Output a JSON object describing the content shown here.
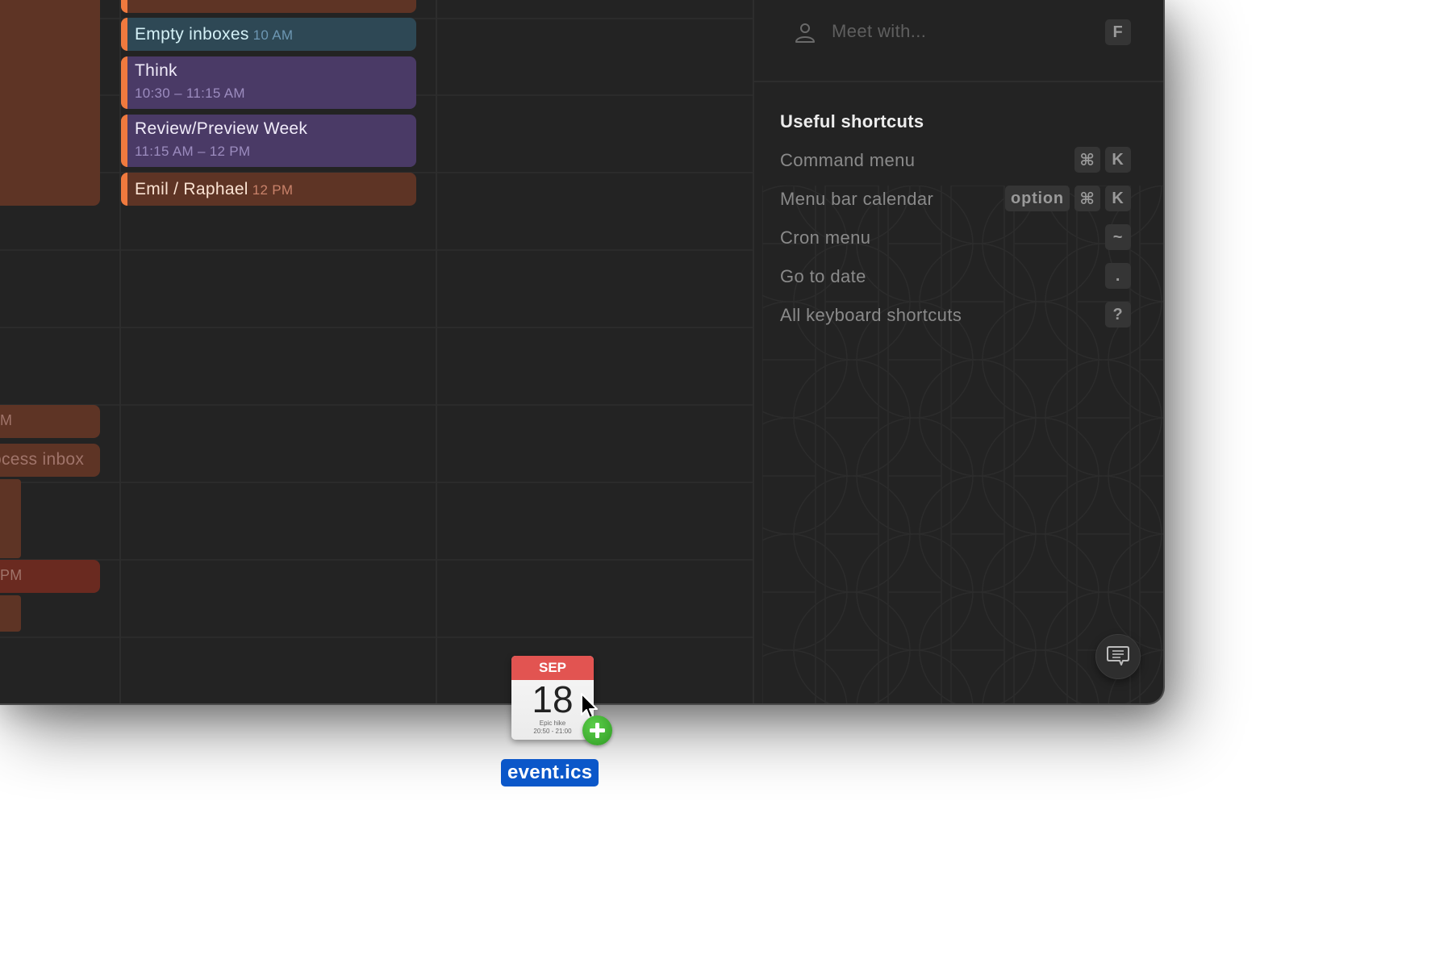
{
  "calendar": {
    "column_left": {
      "events": [
        {
          "label": "",
          "color": "#5e3425"
        },
        {
          "label": "M",
          "color": "#5e3425"
        },
        {
          "label": "ocess inbox",
          "color": "#5e3425"
        },
        {
          "label": "",
          "color": "#5e3425"
        },
        {
          "label": "PM",
          "color": "#6a2a20"
        },
        {
          "label": "",
          "color": "#5e3425"
        }
      ]
    },
    "column_main": {
      "events": [
        {
          "title": "",
          "time": "",
          "color": "#5e3425"
        },
        {
          "title": "Empty inboxes",
          "time": "10 AM",
          "color": "#2e4855"
        },
        {
          "title": "Think",
          "time": "10:30 – 11:15 AM",
          "color": "#4a3a66"
        },
        {
          "title": "Review/Preview Week",
          "time": "11:15 AM – 12 PM",
          "color": "#4a3a66"
        },
        {
          "title": "Emil / Raphael",
          "time": "12 PM",
          "color": "#5e3425"
        }
      ],
      "accent_color": "#f07a3e"
    }
  },
  "side_panel": {
    "meet_with": {
      "placeholder": "Meet with...",
      "shortcut": "F",
      "icon": "person-icon"
    },
    "shortcuts_title": "Useful shortcuts",
    "shortcuts": [
      {
        "label": "Command menu",
        "keys": [
          "⌘",
          "K"
        ]
      },
      {
        "label": "Menu bar calendar",
        "keys": [
          "option",
          "⌘",
          "K"
        ]
      },
      {
        "label": "Cron menu",
        "keys": [
          "~"
        ]
      },
      {
        "label": "Go to date",
        "keys": [
          "."
        ]
      },
      {
        "label": "All keyboard shortcuts",
        "keys": [
          "?"
        ]
      }
    ],
    "feedback_icon": "chat-bubble-icon"
  },
  "drag_item": {
    "month": "SEP",
    "day": "18",
    "event_name": "Epic hike",
    "event_time": "20:50 - 21:00",
    "filename": "event.ics",
    "badge": "plus-icon"
  }
}
